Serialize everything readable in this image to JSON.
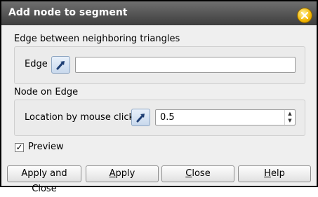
{
  "window": {
    "title": "Add node to segment"
  },
  "edge_group": {
    "title": "Edge between neighboring triangles",
    "edge_label": "Edge",
    "edge_value": ""
  },
  "node_group": {
    "title": "Node on Edge",
    "location_label": "Location by mouse click",
    "location_value": "0.5"
  },
  "preview": {
    "label": "Preview",
    "checked": true,
    "check_glyph": "✓"
  },
  "buttons": {
    "apply_close": "Apply and Close",
    "apply_first": "A",
    "apply_rest": "pply",
    "close_first": "C",
    "close_rest": "lose",
    "help_first": "H",
    "help_rest": "elp"
  },
  "icons": {
    "close": "close-icon",
    "select": "selection-arrow-icon",
    "spin_up": "▲",
    "spin_down": "▼"
  },
  "colors": {
    "titlebar": "#4a4a4a",
    "close_button": "#f2b500",
    "select_button": "#c8d8ec",
    "background": "#efefef"
  }
}
